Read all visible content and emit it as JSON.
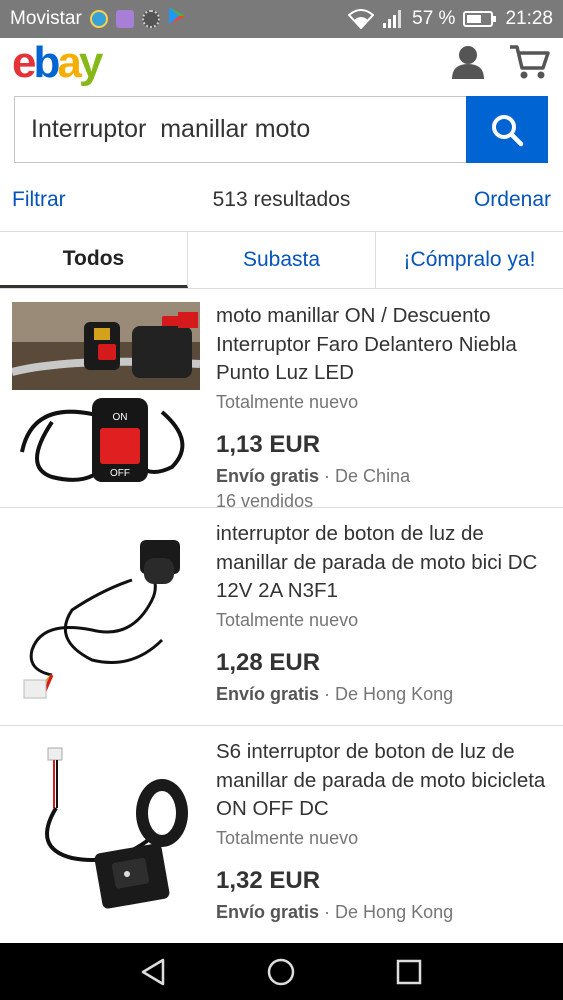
{
  "status_bar": {
    "carrier": "Movistar",
    "battery": "57 %",
    "time": "21:28",
    "icons": [
      "app-icon-1",
      "gallery-icon",
      "settings-icon",
      "play-store-icon",
      "wifi-icon",
      "signal-icon",
      "battery-icon"
    ]
  },
  "header": {
    "logo": [
      "e",
      "b",
      "a",
      "y"
    ],
    "logo_colors": [
      "#e53238",
      "#0064d2",
      "#f5af02",
      "#86b817"
    ]
  },
  "search": {
    "value": "Interruptor  manillar moto",
    "button_color": "#0064d2"
  },
  "results_bar": {
    "filter_label": "Filtrar",
    "count": "513 resultados",
    "sort_label": "Ordenar"
  },
  "tabs": [
    {
      "label": "Todos",
      "active": true
    },
    {
      "label": "Subasta",
      "active": false
    },
    {
      "label": "¡Cómpralo ya!",
      "active": false
    }
  ],
  "listings": [
    {
      "title": "moto manillar ON / Descuento Interruptor Faro Delantero Niebla Punto Luz LED",
      "condition": "Totalmente nuevo",
      "price": "1,13 EUR",
      "shipping": "Envío gratis",
      "origin": "· De China",
      "sold": "16 vendidos",
      "thumb_labels": [
        "ON",
        "OFF"
      ]
    },
    {
      "title": "interruptor de boton de luz de manillar de parada de moto bici DC 12V 2A N3F1",
      "condition": "Totalmente nuevo",
      "price": "1,28 EUR",
      "shipping": "Envío gratis",
      "origin": "· De Hong Kong"
    },
    {
      "title": "S6 interruptor de boton de luz de manillar de parada de moto bicicleta ON OFF DC",
      "condition": "Totalmente nuevo",
      "price": "1,32 EUR",
      "shipping": "Envío gratis",
      "origin": "· De Hong Kong"
    }
  ]
}
